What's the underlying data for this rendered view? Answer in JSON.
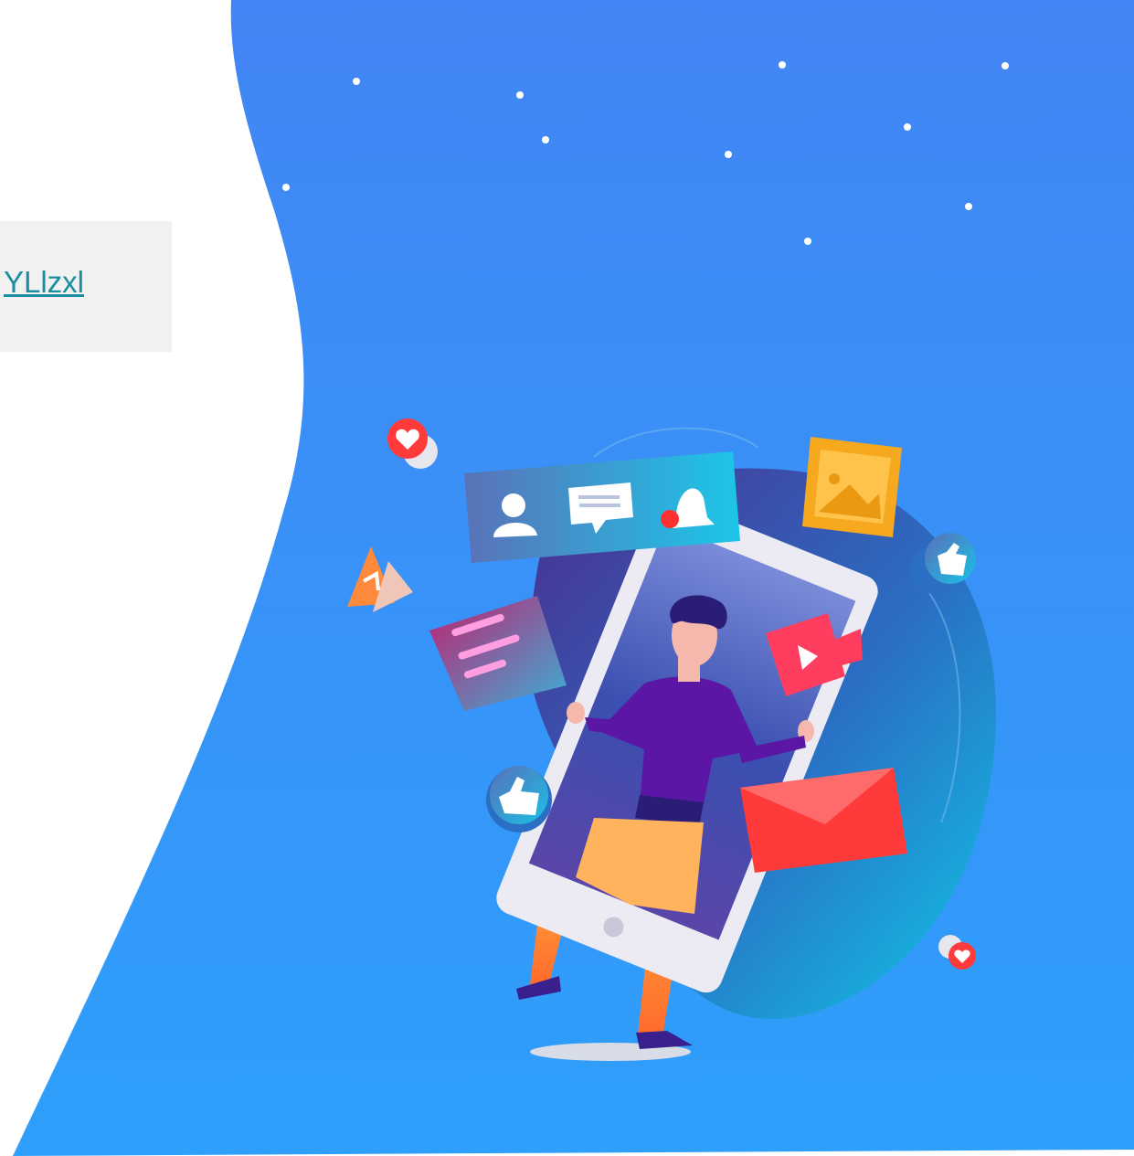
{
  "link": {
    "text": "YLlzxl"
  },
  "colors": {
    "background_top": "#4285f4",
    "background_bottom": "#2e9ffb",
    "link_box": "#f1f1f1",
    "link_text": "#1a8ea0"
  },
  "illustration": {
    "icons": [
      "user-icon",
      "chat-icon",
      "bell-icon",
      "image-icon",
      "video-icon",
      "thumbs-up-icon",
      "heart-icon",
      "music-note-icon",
      "envelope-icon"
    ]
  }
}
